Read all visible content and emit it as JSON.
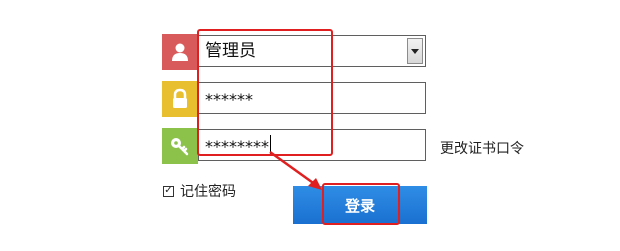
{
  "login_form": {
    "username": {
      "value": "管理员",
      "icon": "user-icon"
    },
    "password": {
      "value": "******",
      "icon": "lock-icon"
    },
    "certificate_password": {
      "value": "********",
      "icon": "key-icon"
    },
    "change_cert_password_label": "更改证书口令",
    "remember_password": {
      "label": "记住密码",
      "checked": true,
      "check_mark": "✓"
    },
    "login_button_label": "登录"
  },
  "colors": {
    "user_icon_bg": "#d85a5a",
    "lock_icon_bg": "#e8bf2e",
    "key_icon_bg": "#8cc24a",
    "button_blue": "#1f7ad8",
    "annotation_red": "#e02020"
  }
}
